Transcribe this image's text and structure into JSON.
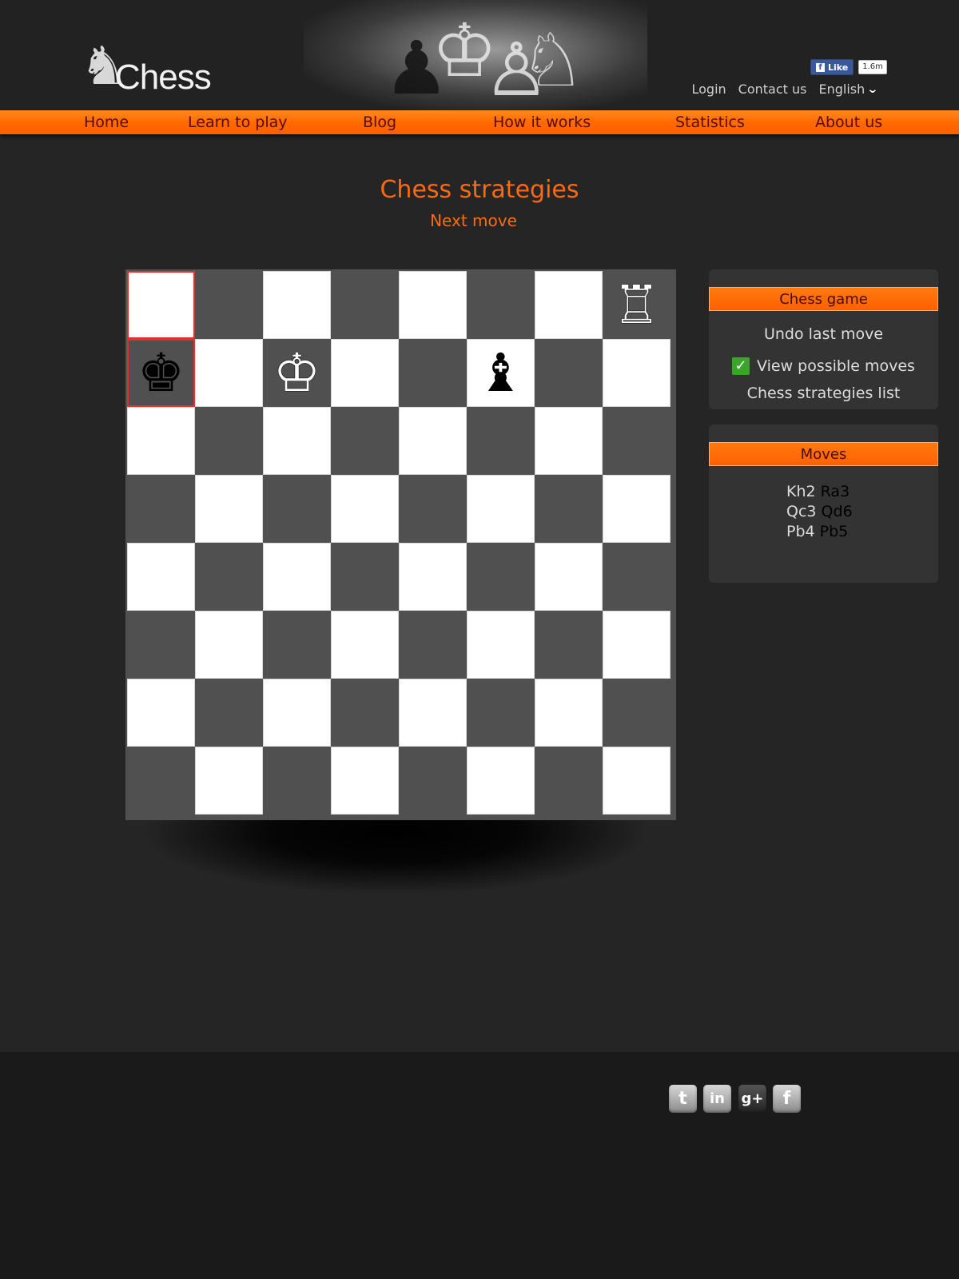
{
  "header": {
    "logo_text": "Chess",
    "fb_like_label": "Like",
    "fb_like_count": "1.6m",
    "top_links": [
      "Login",
      "Contact us"
    ],
    "language": "English"
  },
  "nav": {
    "items": [
      "Home",
      "Learn to play",
      "Blog",
      "How it works",
      "Statistics",
      "About us"
    ]
  },
  "page": {
    "title": "Chess strategies",
    "subtitle": "Next move"
  },
  "board": {
    "selected_squares": [
      "a8",
      "a7"
    ],
    "pieces": [
      {
        "square": "h8",
        "piece": "white-rook",
        "glyph": "♖"
      },
      {
        "square": "a7",
        "piece": "black-king",
        "glyph": "♚"
      },
      {
        "square": "c7",
        "piece": "white-king",
        "glyph": "♔"
      },
      {
        "square": "f7",
        "piece": "black-bishop",
        "glyph": "♝"
      }
    ]
  },
  "game_panel": {
    "title": "Chess game",
    "undo_label": "Undo last move",
    "view_moves_label": "View possible moves",
    "view_moves_checked": true,
    "strategies_label": "Chess strategies list"
  },
  "moves_panel": {
    "title": "Moves",
    "moves": [
      {
        "white": "Kh2",
        "black": "Ra3"
      },
      {
        "white": "Qc3",
        "black": "Qd6"
      },
      {
        "white": "Pb4",
        "black": "Pb5"
      }
    ]
  },
  "footer": {
    "social_icons": [
      "twitter-icon",
      "linkedin-icon",
      "google-plus-icon",
      "facebook-icon"
    ]
  },
  "colors": {
    "accent": "#ff6a10",
    "nav_text": "#5a0a00",
    "background": "#252525",
    "footer": "#1a1a1a",
    "selection": "#e23030"
  }
}
